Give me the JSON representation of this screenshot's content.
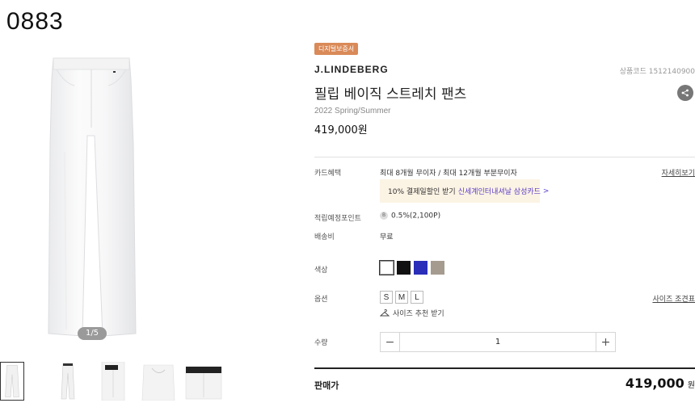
{
  "header": {
    "code": "0883"
  },
  "gallery": {
    "page_indicator": "1/5",
    "thumbnails": [
      "thumb-1",
      "thumb-2",
      "thumb-3",
      "thumb-4",
      "thumb-5"
    ]
  },
  "product": {
    "badge": "디지털보증서",
    "brand": "J.LINDEBERG",
    "code_label": "상품코드 1512140900",
    "title": "필립 베이직 스트레치 팬츠",
    "season": "2022 Spring/Summer",
    "price": "419,000원"
  },
  "card_benefit": {
    "label": "카드혜택",
    "value": "최대 8개월 무이자 / 최대 12개월 부분무이자",
    "link": "자세히보기",
    "promo_text": "10% 결제일할인 받기",
    "promo_accent": "신세계인터내셔날 삼성카드",
    "promo_chevron": ">"
  },
  "points": {
    "label": "적립예정포인트",
    "icon_letter": "B",
    "value": "0.5%(2,100P)"
  },
  "shipping": {
    "label": "배송비",
    "value": "무료"
  },
  "colors": {
    "label": "색상",
    "options": [
      "#ffffff",
      "#111111",
      "#2a2eb8",
      "#a59b8f"
    ]
  },
  "options": {
    "label": "옵션",
    "sizes": [
      "S",
      "M",
      "L"
    ],
    "size_rec": "사이즈 추천 받기",
    "size_guide": "사이즈 조견표"
  },
  "quantity": {
    "label": "수량",
    "value": "1",
    "minus": "−",
    "plus": "+"
  },
  "total": {
    "label": "판매가",
    "price": "419,000",
    "unit": "원"
  }
}
